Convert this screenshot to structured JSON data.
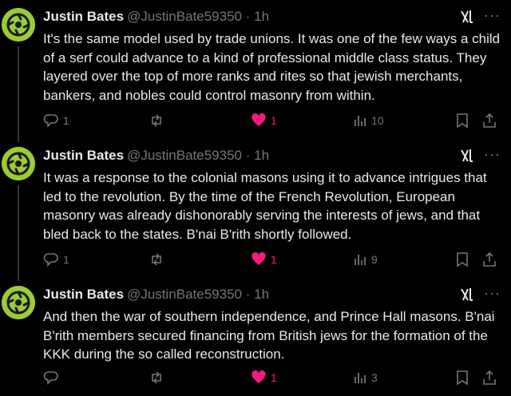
{
  "posts": [
    {
      "author_name": "Justin Bates",
      "handle": "@JustinBate59350",
      "separator": "·",
      "time": "1h",
      "text": "It's the same model used by trade unions. It was one of the few ways a child of a serf could advance to a kind of professional middle class status. They layered over the top of more ranks and rites so that jewish merchants, bankers, and nobles could control masonry from within.",
      "replies": "1",
      "reposts": "",
      "likes": "1",
      "views": "10",
      "liked": true
    },
    {
      "author_name": "Justin Bates",
      "handle": "@JustinBate59350",
      "separator": "·",
      "time": "1h",
      "text": "It was a response to the colonial masons using it to advance intrigues that led to the revolution. By the time of the French Revolution, European masonry was already dishonorably serving the interests of jews, and that bled back to the states. B'nai B'rith shortly followed.",
      "replies": "1",
      "reposts": "",
      "likes": "1",
      "views": "9",
      "liked": true
    },
    {
      "author_name": "Justin Bates",
      "handle": "@JustinBate59350",
      "separator": "·",
      "time": "1h",
      "text": "And then the war of southern independence, and Prince Hall masons. B'nai B'rith members secured financing from British jews for the formation of the KKK during the so called reconstruction.",
      "replies": "",
      "reposts": "",
      "likes": "1",
      "views": "3",
      "liked": true
    }
  ],
  "more_label": "···",
  "colors": {
    "like": "#f91880",
    "muted": "#71767b",
    "text": "#e7e9ea",
    "avatar": "#9acd32"
  },
  "icons": [
    "reply-icon",
    "repost-icon",
    "heart-icon",
    "views-icon",
    "bookmark-icon",
    "share-icon",
    "grok-icon",
    "more-icon"
  ]
}
